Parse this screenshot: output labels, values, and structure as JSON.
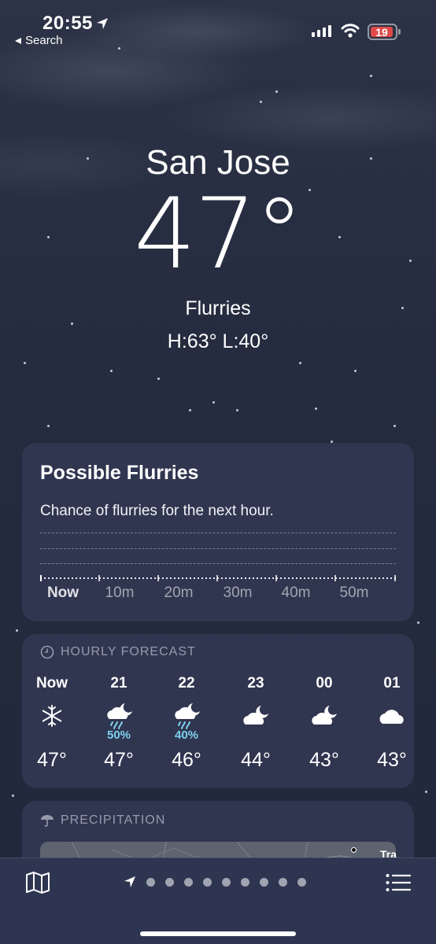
{
  "status_bar": {
    "time": "20:55",
    "back_label": "Search",
    "battery": "19",
    "battery_color": "#e04a48"
  },
  "hero": {
    "city": "San Jose",
    "temperature": "47°",
    "condition": "Flurries",
    "high_low": "H:63°  L:40°"
  },
  "nowcast": {
    "title": "Possible Flurries",
    "subtitle": "Chance of flurries for the next hour.",
    "ticks": [
      "Now",
      "10m",
      "20m",
      "30m",
      "40m",
      "50m"
    ]
  },
  "hourly": {
    "heading": "HOURLY FORECAST",
    "icon": "clock-icon",
    "hours": [
      {
        "label": "Now",
        "icon": "snowflake-icon",
        "chance": "",
        "temp": "47°"
      },
      {
        "label": "21",
        "icon": "moon-cloud-rain-icon",
        "chance": "50%",
        "temp": "47°"
      },
      {
        "label": "22",
        "icon": "moon-cloud-rain-icon",
        "chance": "40%",
        "temp": "46°"
      },
      {
        "label": "23",
        "icon": "moon-cloud-icon",
        "chance": "",
        "temp": "44°"
      },
      {
        "label": "00",
        "icon": "moon-cloud-icon",
        "chance": "",
        "temp": "43°"
      },
      {
        "label": "01",
        "icon": "cloud-icon",
        "chance": "",
        "temp": "43°"
      }
    ]
  },
  "precipitation": {
    "heading": "PRECIPITATION",
    "icon": "umbrella-icon",
    "map_label": "Tra"
  },
  "tab_bar": {
    "left_icon": "map-icon",
    "right_icon": "list-icon",
    "page_count": 9
  },
  "colors": {
    "accent_precip": "#7ed0ee",
    "card": "#343a56"
  }
}
